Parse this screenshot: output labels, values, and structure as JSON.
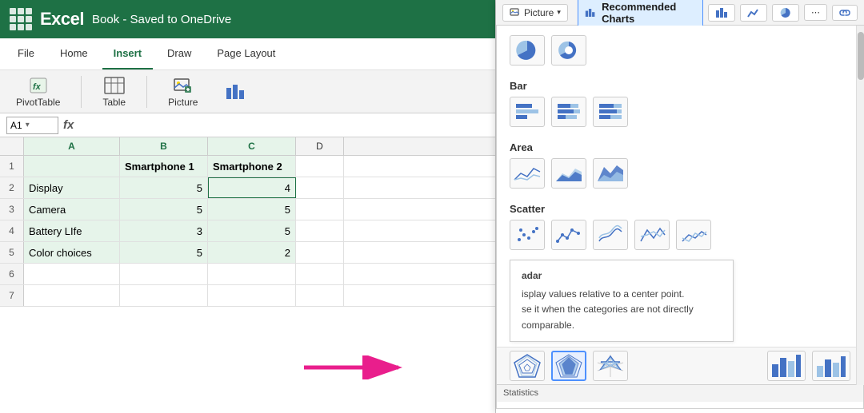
{
  "app": {
    "name": "Excel",
    "title": "Book - Saved to OneDrive",
    "logo_dots": 9
  },
  "ribbon": {
    "tabs": [
      "File",
      "Home",
      "Insert",
      "Draw",
      "Page Layout"
    ],
    "active_tab": "Insert",
    "toolbar_buttons": [
      {
        "id": "pivottable",
        "label": "PivotTable"
      },
      {
        "id": "table",
        "label": "Table"
      },
      {
        "id": "picture",
        "label": "Picture"
      }
    ]
  },
  "formula_bar": {
    "cell_ref": "A1",
    "fx_symbol": "fx",
    "value": ""
  },
  "spreadsheet": {
    "columns": [
      "A",
      "B",
      "C",
      "D"
    ],
    "rows": [
      {
        "num": 1,
        "cells": [
          "",
          "Smartphone 1",
          "Smartphone 2",
          ""
        ]
      },
      {
        "num": 2,
        "cells": [
          "Display",
          "5",
          "4",
          ""
        ]
      },
      {
        "num": 3,
        "cells": [
          "Camera",
          "5",
          "5",
          ""
        ]
      },
      {
        "num": 4,
        "cells": [
          "Battery LIfe",
          "3",
          "5",
          ""
        ]
      },
      {
        "num": 5,
        "cells": [
          "Color choices",
          "5",
          "2",
          ""
        ]
      },
      {
        "num": 6,
        "cells": [
          "",
          "",
          "",
          ""
        ]
      },
      {
        "num": 7,
        "cells": [
          "",
          "",
          "",
          ""
        ]
      }
    ]
  },
  "chart_panel": {
    "picture_btn": "Picture",
    "recommended_charts_label": "Recommended Charts",
    "sections": [
      {
        "id": "pie",
        "icons": [
          "pie-filled",
          "donut"
        ]
      },
      {
        "id": "bar",
        "title": "Bar",
        "icons": [
          "bar-clustered",
          "bar-stacked",
          "bar-100"
        ]
      },
      {
        "id": "area",
        "title": "Area",
        "icons": [
          "area-line",
          "area-filled",
          "area-filled2"
        ]
      },
      {
        "id": "scatter",
        "title": "Scatter",
        "icons": [
          "scatter-dots",
          "scatter-lines",
          "scatter-smooth",
          "scatter-x",
          "scatter-lines2"
        ]
      }
    ],
    "radar_section": {
      "label": "Radar",
      "tooltip_title": "adar",
      "tooltip_line1": "isplay values relative to a center point.",
      "tooltip_line2": "se it when the categories are not directly comparable.",
      "icons": [
        "radar-basic",
        "radar-filled",
        "radar-star"
      ]
    },
    "bottom_bar": "Statistics"
  },
  "arrow": {
    "color": "#e91e8c"
  },
  "colors": {
    "excel_green": "#1e7145",
    "accent_blue": "#4472c4",
    "light_blue": "#9dc3e6",
    "selected_green_bg": "#e6f4ea"
  }
}
